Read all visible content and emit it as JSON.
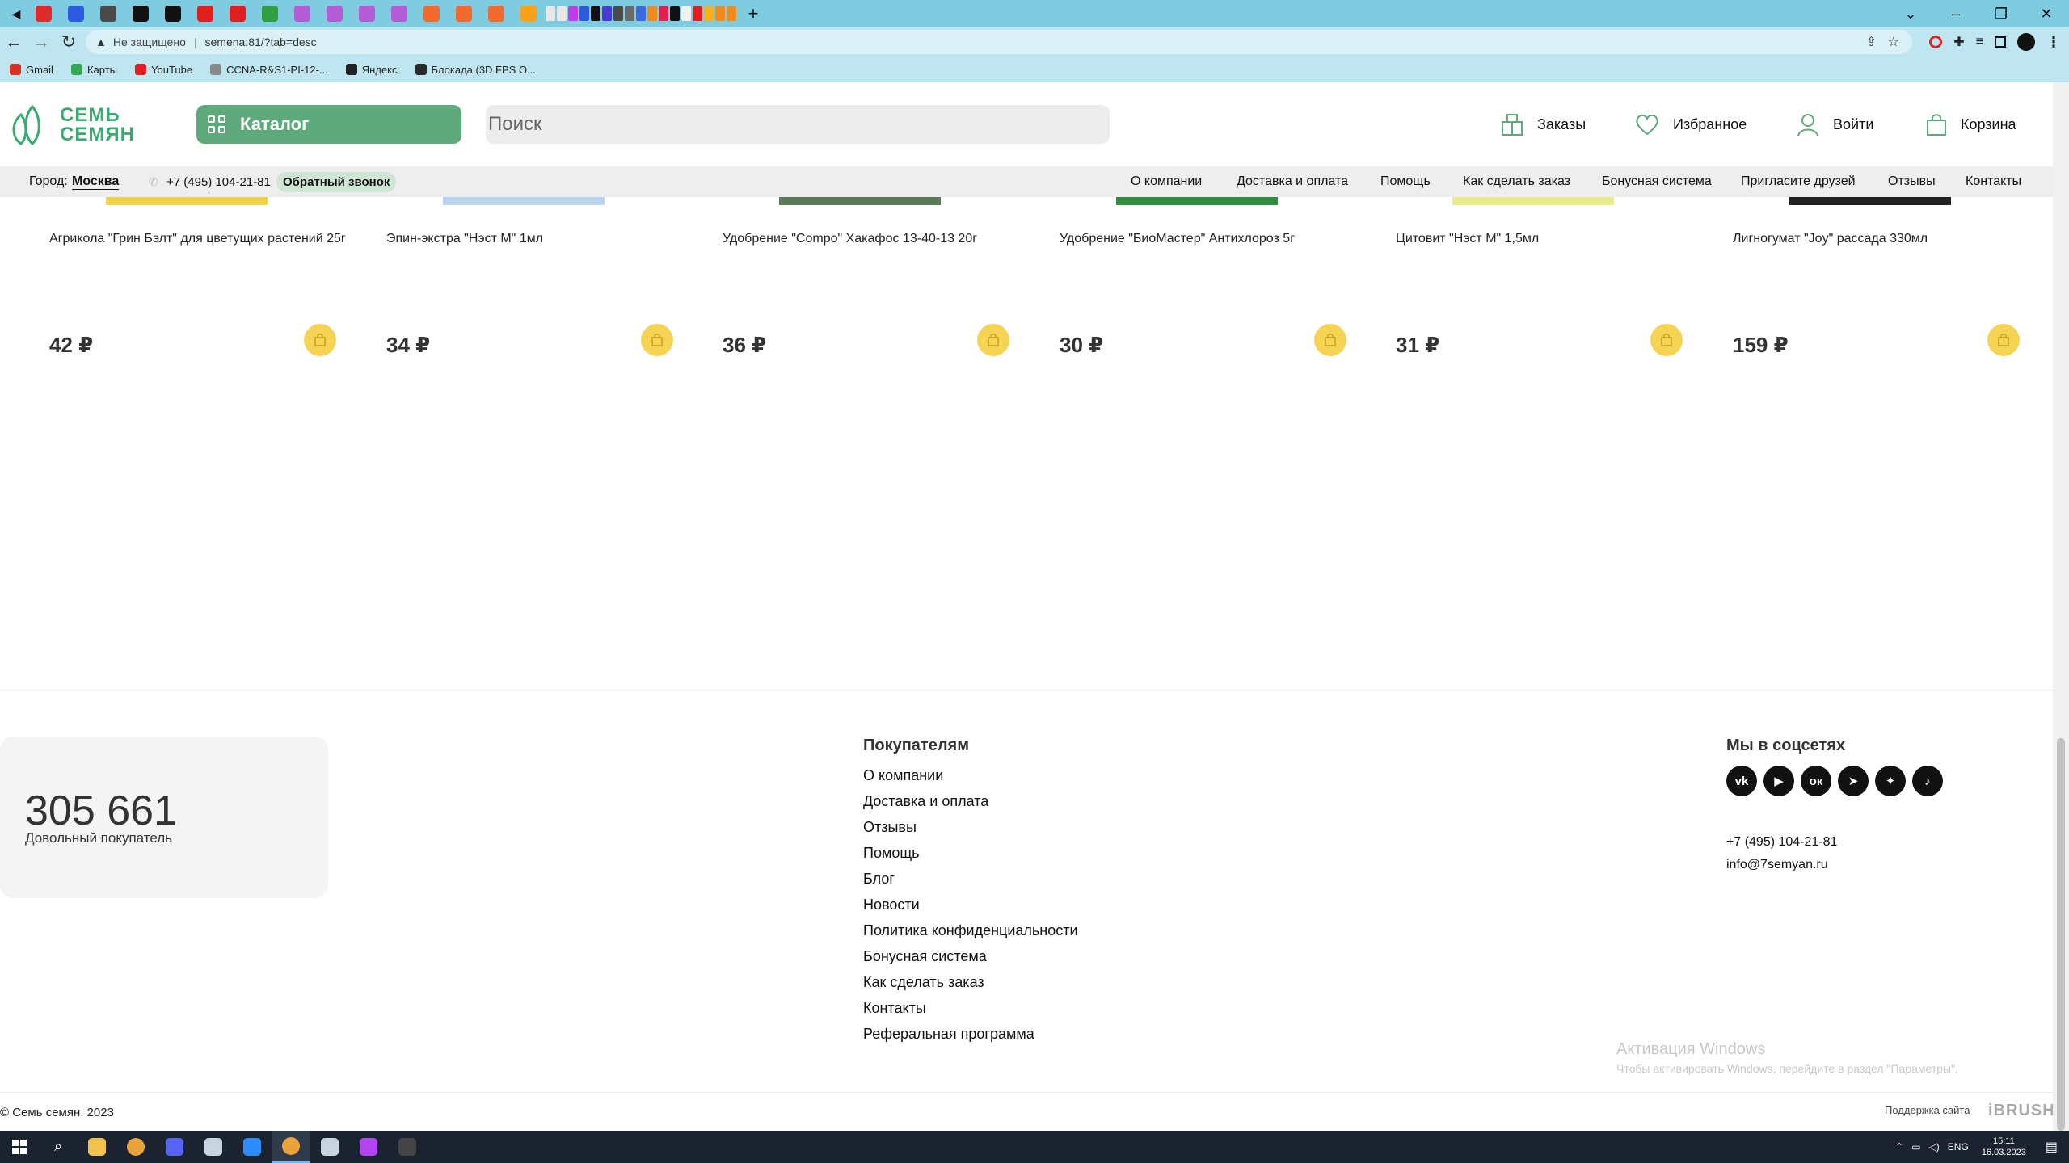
{
  "browser": {
    "security_label": "Не защищено",
    "url": "semena:81/?tab=desc",
    "tab_colors": [
      "#e02b2b",
      "#2b5be0",
      "#4a4a4a",
      "#111111",
      "#111111",
      "#e02020",
      "#e02020",
      "#2ea043",
      "#b45bd6",
      "#b45bd6",
      "#b45bd6",
      "#b45bd6",
      "#f26a2e",
      "#f26a2e",
      "#f26a2e",
      "#f7a21b",
      "#e8e8e8",
      "#e8e8e8",
      "#c43ae6",
      "#2b5be0",
      "#111111",
      "#4a3ad6",
      "#4a4a4a",
      "#6a6a6a",
      "#3a6ae0",
      "#f28a1b",
      "#e02050",
      "#111111",
      "#f0f0f0",
      "#e02020",
      "#f7b01b",
      "#f28a1b",
      "#f28a1b"
    ],
    "bookmarks": [
      {
        "label": "Gmail",
        "color": "#d93025"
      },
      {
        "label": "Карты",
        "color": "#34a853"
      },
      {
        "label": "YouTube",
        "color": "#e02020"
      },
      {
        "label": "CCNA-R&S1-PI-12-...",
        "color": "#888888"
      },
      {
        "label": "Яндекс",
        "color": "#222222"
      },
      {
        "label": "Блокада (3D FPS О...",
        "color": "#2a2a2a"
      }
    ]
  },
  "header": {
    "logo_line1": "СЕМЬ",
    "logo_line2": "СЕМЯН",
    "catalog_label": "Каталог",
    "search_placeholder": "Поиск",
    "orders_label": "Заказы",
    "favorites_label": "Избранное",
    "login_label": "Войти",
    "cart_label": "Корзина",
    "brand_color": "#5eaa7c",
    "logo_color": "#3cab72"
  },
  "infobar": {
    "city_label": "Город:",
    "city_value": "Москва",
    "phone": "+7 (495) 104-21-81",
    "callback_label": "Обратный звонок",
    "menu": [
      "О компании",
      "Доставка и оплата",
      "Помощь",
      "Как сделать заказ",
      "Бонусная система",
      "Пригласите друзей",
      "Отзывы",
      "Контакты"
    ]
  },
  "products": [
    {
      "name": "Агрикола \"Грин Бэлт\" для цветущих растений 25г",
      "price": "42 ₽",
      "img_color": "#f0d24a"
    },
    {
      "name": "Эпин-экстра \"Нэст М\" 1мл",
      "price": "34 ₽",
      "img_color": "#bcd3ec"
    },
    {
      "name": "Удобрение \"Compo\" Хакафос 13-40-13 20г",
      "price": "36 ₽",
      "img_color": "#5b7a5b"
    },
    {
      "name": "Удобрение \"БиоМастер\" Антихлороз 5г",
      "price": "30 ₽",
      "img_color": "#2f8f3f"
    },
    {
      "name": "Цитовит \"Нэст М\" 1,5мл",
      "price": "31 ₽",
      "img_color": "#e8ed8a"
    },
    {
      "name": "Лигногумат \"Joy\" рассада 330мл",
      "price": "159 ₽",
      "img_color": "#222222"
    }
  ],
  "footer": {
    "counter_value": "305 661",
    "counter_label": "Довольный покупатель",
    "buyers_title": "Покупателям",
    "buyers_links": [
      "О компании",
      "Доставка и оплата",
      "Отзывы",
      "Помощь",
      "Блог",
      "Новости",
      "Политика конфиденциальности",
      "Бонусная система",
      "Как сделать заказ",
      "Контакты",
      "Реферальная программа"
    ],
    "social_title": "Мы в соцсетях",
    "social": [
      "vk-icon",
      "youtube-icon",
      "odnoklassniki-icon",
      "telegram-icon",
      "dzen-icon",
      "tiktok-icon"
    ],
    "phone": "+7 (495) 104-21-81",
    "email": "info@7semyan.ru",
    "activation_title": "Активация Windows",
    "activation_text": "Чтобы активировать Windows, перейдите в раздел \"Параметры\".",
    "copyright": "© Семь семян, 2023",
    "support_label": "Поддержка сайта",
    "developer": "iBRUSH"
  },
  "taskbar": {
    "apps": [
      {
        "name": "file-explorer",
        "color": "#f2c14e"
      },
      {
        "name": "chrome",
        "color": "#e8a33d"
      },
      {
        "name": "discord",
        "color": "#5865f2"
      },
      {
        "name": "steam",
        "color": "#c7d5e0"
      },
      {
        "name": "zoom",
        "color": "#2d8cff"
      },
      {
        "name": "chrome-active",
        "color": "#e8a33d"
      },
      {
        "name": "steam-2",
        "color": "#c7d5e0"
      },
      {
        "name": "phpstorm",
        "color": "#b345f1"
      },
      {
        "name": "terminal",
        "color": "#444444"
      }
    ],
    "language": "ENG",
    "time": "15:11",
    "date": "16.03.2023"
  }
}
